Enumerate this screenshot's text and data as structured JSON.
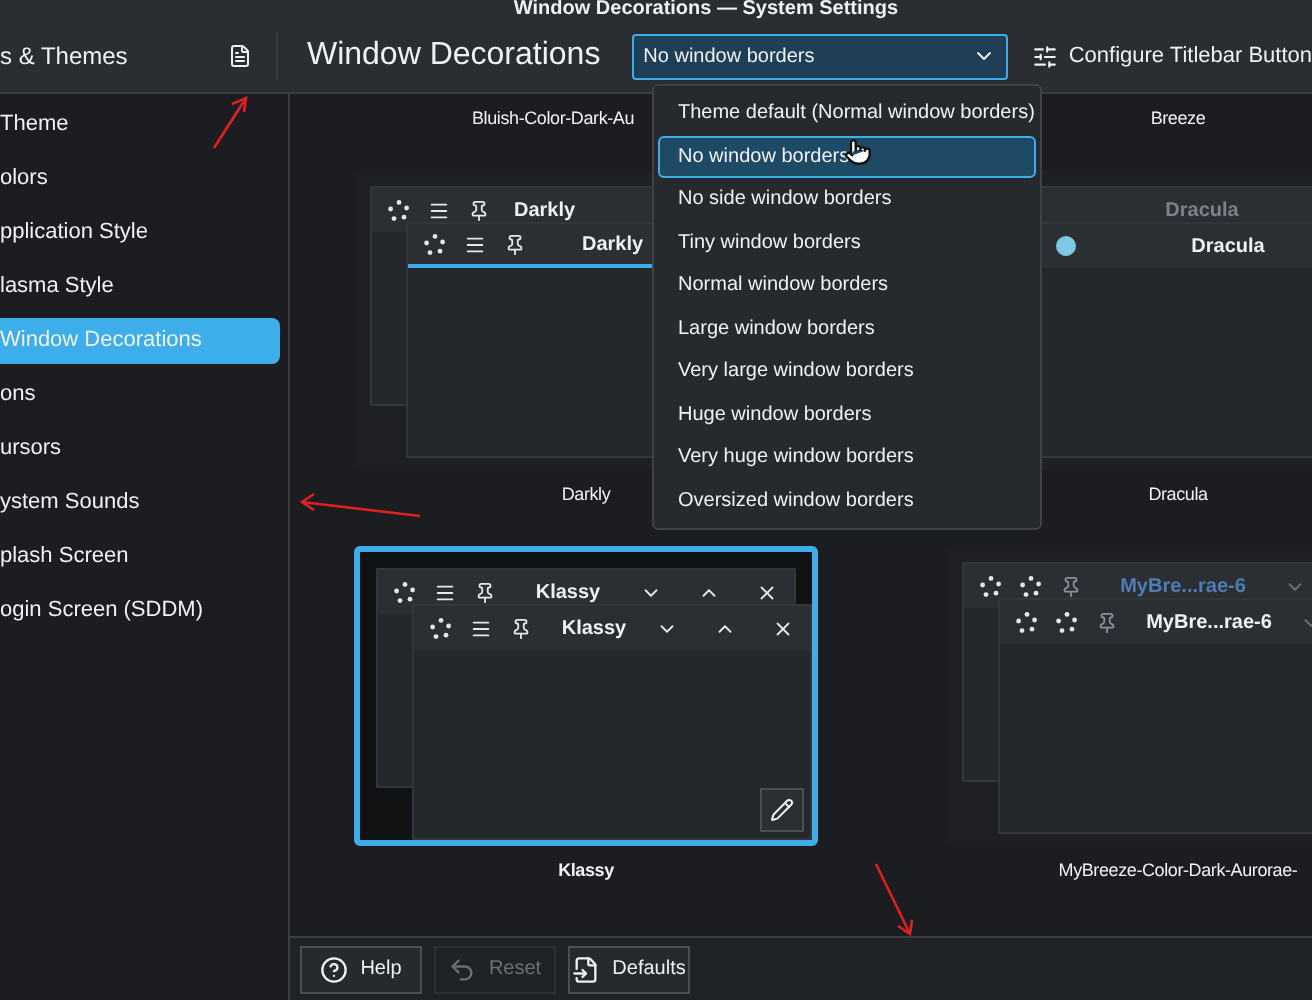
{
  "window": {
    "title": "Window Decorations — System Settings"
  },
  "sidebar": {
    "header": "s & Themes",
    "items": [
      {
        "label": "Theme",
        "selected": false
      },
      {
        "label": "olors",
        "selected": false
      },
      {
        "label": "pplication Style",
        "selected": false
      },
      {
        "label": "lasma Style",
        "selected": false
      },
      {
        "label": "Window Decorations",
        "selected": true
      },
      {
        "label": "ons",
        "selected": false
      },
      {
        "label": "ursors",
        "selected": false
      },
      {
        "label": "ystem Sounds",
        "selected": false
      },
      {
        "label": "plash Screen",
        "selected": false
      },
      {
        "label": "ogin Screen (SDDM)",
        "selected": false
      }
    ]
  },
  "page": {
    "title": "Window Decorations",
    "border_size": {
      "value": "No window borders",
      "options": [
        {
          "label": "Theme default (Normal window borders)",
          "selected": false
        },
        {
          "label": "No window borders",
          "selected": true
        },
        {
          "label": "No side window borders",
          "selected": false
        },
        {
          "label": "Tiny window borders",
          "selected": false
        },
        {
          "label": "Normal window borders",
          "selected": false
        },
        {
          "label": "Large window borders",
          "selected": false
        },
        {
          "label": "Very large window borders",
          "selected": false
        },
        {
          "label": "Huge window borders",
          "selected": false
        },
        {
          "label": "Very huge window borders",
          "selected": false
        },
        {
          "label": "Oversized window borders",
          "selected": false
        }
      ]
    },
    "configure_button": "Configure Titlebar Button"
  },
  "themes": [
    {
      "name": "Bluish-Color-Dark-Au",
      "kind": "label",
      "selected": false
    },
    {
      "name": "Breeze",
      "kind": "label",
      "selected": false
    },
    {
      "name": "Darkly",
      "kind": "darkly",
      "selected": false,
      "windows": [
        "Darkly",
        "Darkly"
      ]
    },
    {
      "name": "Dracula",
      "kind": "dracula",
      "selected": false,
      "windows": [
        "Dracula",
        "Dracula"
      ]
    },
    {
      "name": "Klassy",
      "kind": "klassy",
      "selected": true,
      "windows": [
        "Klassy",
        "Klassy"
      ]
    },
    {
      "name": "MyBreeze-Color-Dark-Aurorae-",
      "kind": "mybreeze",
      "selected": false,
      "windows": [
        "MyBre...rae-6",
        "MyBre...rae-6"
      ]
    }
  ],
  "footer": [
    {
      "label": "Help",
      "kind": "help",
      "disabled": false
    },
    {
      "label": "Reset",
      "kind": "reset",
      "disabled": true
    },
    {
      "label": "Defaults",
      "kind": "defaults",
      "disabled": false
    }
  ]
}
